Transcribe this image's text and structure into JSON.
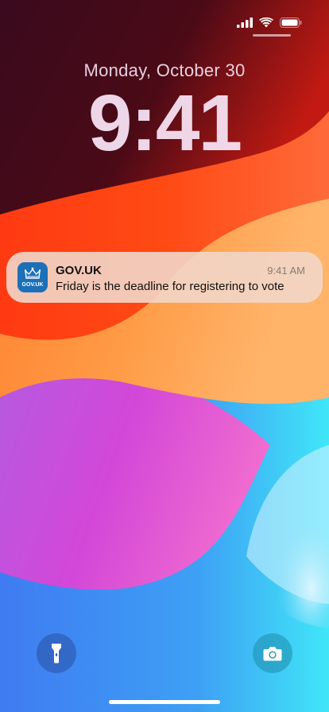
{
  "lockscreen": {
    "date": "Monday, October 30",
    "time": "9:41"
  },
  "status_bar": {
    "icons": [
      "cellular-signal-icon",
      "wifi-icon",
      "battery-icon"
    ]
  },
  "notification": {
    "app_name": "GOV.UK",
    "time": "9:41 AM",
    "message": "Friday is the deadline for registering to vote",
    "icon_label": "GOV.UK",
    "icon_color": "#1d70b8"
  },
  "quick_actions": {
    "left_icon": "flashlight-icon",
    "right_icon": "camera-icon"
  }
}
